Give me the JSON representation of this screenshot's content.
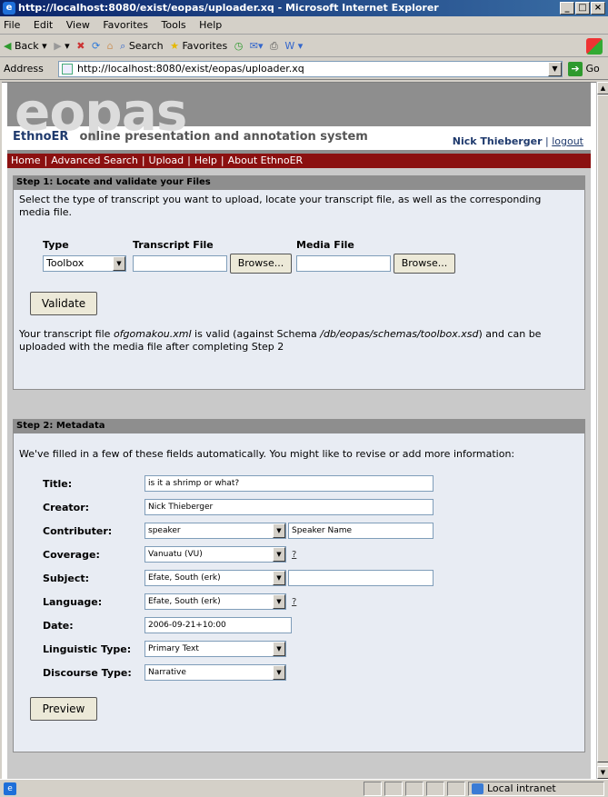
{
  "window": {
    "title": "http://localhost:8080/exist/eopas/uploader.xq - Microsoft Internet Explorer",
    "min": "_",
    "max": "□",
    "close": "×"
  },
  "menu": [
    "File",
    "Edit",
    "View",
    "Favorites",
    "Tools",
    "Help"
  ],
  "toolbar": {
    "back": "Back",
    "search": "Search",
    "favorites": "Favorites"
  },
  "address": {
    "label": "Address",
    "url": "http://localhost:8080/exist/eopas/uploader.xq",
    "go": "Go"
  },
  "site": {
    "logo": "eopas",
    "brand": "EthnoER",
    "tagline": "online presentation and annotation system",
    "user": "Nick Thieberger",
    "logout": "logout",
    "nav": [
      "Home",
      "Advanced Search",
      "Upload",
      "Help",
      "About EthnoER"
    ]
  },
  "step1": {
    "header": "Step 1: Locate and validate your Files",
    "intro": "Select the type of transcript you want to upload, locate your transcript file, as well as the corresponding media file.",
    "type_label": "Type",
    "transcript_label": "Transcript File",
    "media_label": "Media File",
    "type_value": "Toolbox",
    "browse": "Browse...",
    "validate": "Validate",
    "result_pre": "Your transcript file ",
    "result_file": "ofgomakou.xml",
    "result_mid": " is valid (against Schema ",
    "result_schema": "/db/eopas/schemas/toolbox.xsd",
    "result_post": ") and can be uploaded with the media file after completing Step 2"
  },
  "step2": {
    "header": "Step 2: Metadata",
    "intro": "We've filled in a few of these fields automatically. You might like to revise or add more information:",
    "fields": {
      "title_label": "Title:",
      "title_value": "is it a shrimp or what?",
      "creator_label": "Creator:",
      "creator_value": "Nick Thieberger",
      "contributer_label": "Contributer:",
      "contributer_role": "speaker",
      "contributer_name": "Speaker Name",
      "coverage_label": "Coverage:",
      "coverage_value": "Vanuatu (VU)",
      "subject_label": "Subject:",
      "subject_value": "Efate, South (erk)",
      "subject_extra": "",
      "language_label": "Language:",
      "language_value": "Efate, South (erk)",
      "date_label": "Date:",
      "date_value": "2006-09-21+10:00",
      "ling_label": "Linguistic Type:",
      "ling_value": "Primary Text",
      "disc_label": "Discourse Type:",
      "disc_value": "Narrative"
    },
    "help": "?",
    "preview": "Preview"
  },
  "status": {
    "zone": "Local intranet"
  }
}
